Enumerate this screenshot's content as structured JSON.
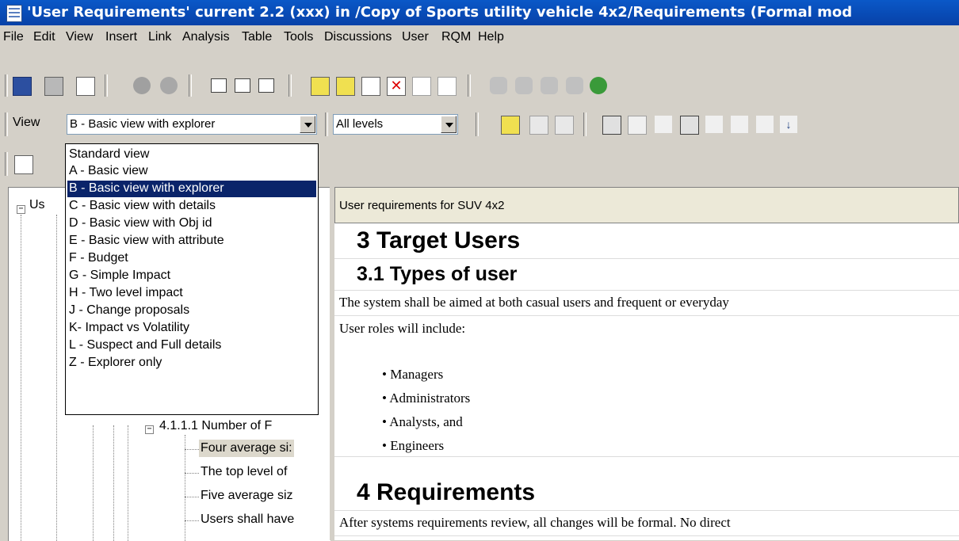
{
  "window": {
    "title": "'User Requirements' current 2.2 (xxx) in /Copy of Sports utility vehicle 4x2/Requirements (Formal mod"
  },
  "menu": [
    "File",
    "Edit",
    "View",
    "Insert",
    "Link",
    "Analysis",
    "Table",
    "Tools",
    "Discussions",
    "User",
    "RQM",
    "Help"
  ],
  "toolbar": {
    "view_label": "View",
    "view_selected": "B - Basic view with explorer",
    "levels_selected": "All levels"
  },
  "view_options": [
    "Standard view",
    "A - Basic view",
    "B - Basic view with explorer",
    "C - Basic view with details",
    "D - Basic view with Obj id",
    "E - Basic view with attribute",
    "F - Budget",
    "G - Simple Impact",
    "H - Two level impact",
    "J - Change proposals",
    "K- Impact vs Volatility",
    "L - Suspect and Full details",
    "Z - Explorer only"
  ],
  "tree": {
    "root_label": "Us",
    "nodes": [
      "4.1.1.1 Number of F",
      "Four average si:",
      "The top level of",
      "Five average siz",
      "Users shall have"
    ]
  },
  "document": {
    "header": "User requirements for SUV 4x2",
    "rows": [
      {
        "kind": "h1",
        "text": "3 Target Users"
      },
      {
        "kind": "h2",
        "text": "3.1 Types of user"
      },
      {
        "kind": "para",
        "text": "The system shall be aimed at both casual users and frequent or everyday"
      },
      {
        "kind": "para",
        "text": "User roles will include:"
      },
      {
        "kind": "bullet",
        "text": "• Managers"
      },
      {
        "kind": "bullet",
        "text": "• Administrators"
      },
      {
        "kind": "bullet",
        "text": "• Analysts, and"
      },
      {
        "kind": "bullet",
        "text": "• Engineers"
      },
      {
        "kind": "h1",
        "text": "4 Requirements"
      },
      {
        "kind": "para",
        "text": "After systems requirements review, all changes will be formal. No direct"
      }
    ]
  },
  "colors": {
    "title_bar": "#0a58c8",
    "selection": "#0a246a",
    "chrome": "#d4d0c8"
  }
}
